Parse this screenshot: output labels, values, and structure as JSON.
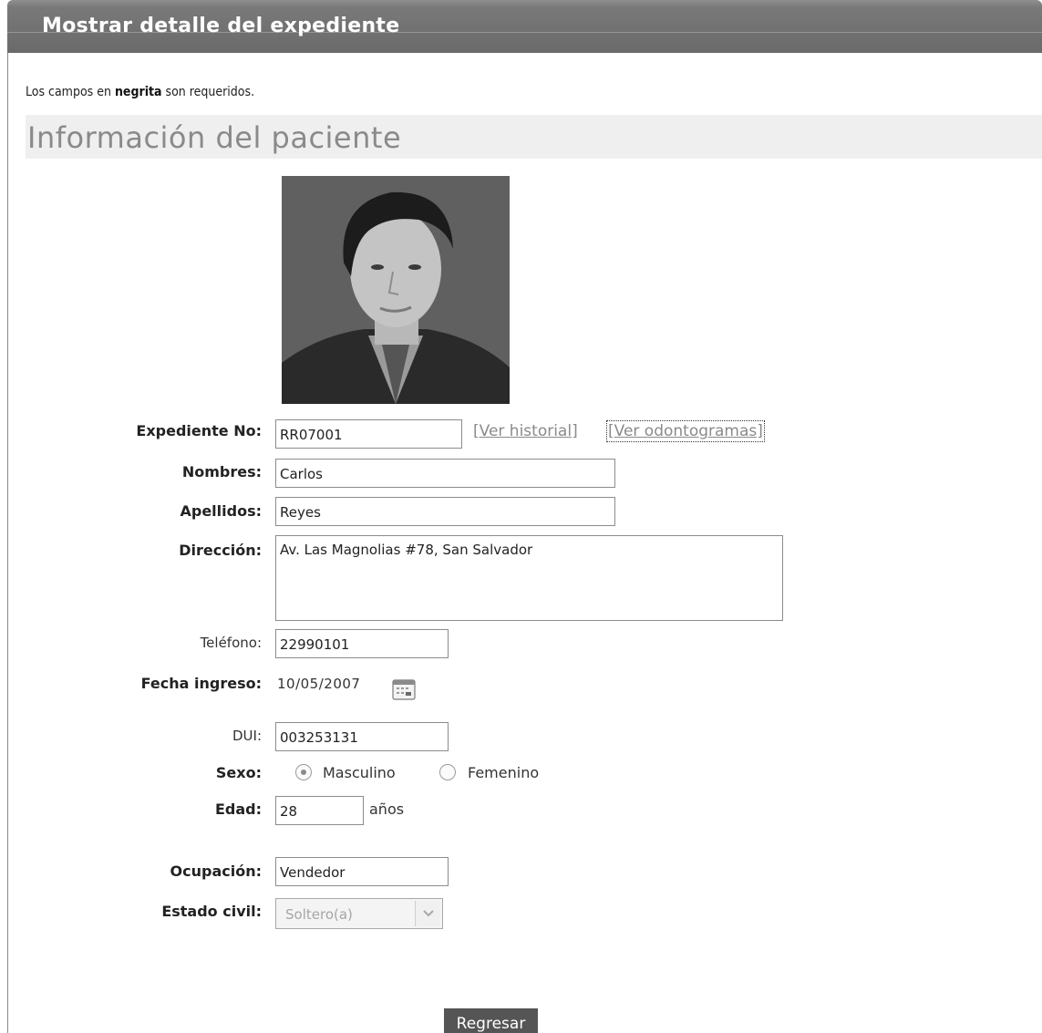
{
  "window": {
    "title": "Mostrar detalle del expediente"
  },
  "form": {
    "required_note_prefix": "Los campos en ",
    "required_note_bold": "negrita",
    "required_note_suffix": " son requeridos.",
    "section_title": "Información del paciente",
    "fields": {
      "expediente": {
        "label": "Expediente No:",
        "value": "RR07001"
      },
      "nombres": {
        "label": "Nombres:",
        "value": "Carlos"
      },
      "apellidos": {
        "label": "Apellidos:",
        "value": "Reyes"
      },
      "direccion": {
        "label": "Dirección:",
        "value": "Av. Las Magnolias #78, San Salvador"
      },
      "telefono": {
        "label": "Teléfono:",
        "value": "22990101"
      },
      "fecha_ingreso": {
        "label": "Fecha ingreso:",
        "value": "10/05/2007"
      },
      "dui": {
        "label": "DUI:",
        "value": "003253131"
      },
      "sexo": {
        "label": "Sexo:",
        "options": [
          "Masculino",
          "Femenino"
        ],
        "selected": "Masculino"
      },
      "edad": {
        "label": "Edad:",
        "value": "28",
        "suffix": "años"
      },
      "ocupacion": {
        "label": "Ocupación:",
        "value": "Vendedor"
      },
      "estado_civil": {
        "label": "Estado civil:",
        "value": "Soltero(a)"
      }
    },
    "links": {
      "historial": "[Ver historial]",
      "odontogramas": "[Ver odontogramas]"
    },
    "back_button": "Regresar"
  },
  "icons": {
    "calendar": "calendar-icon",
    "select_arrow": "chevron-down-icon"
  },
  "colors": {
    "header": "#777777",
    "section_bg": "#efefef",
    "section_title": "#8a8a8a",
    "link": "#8a8a8a",
    "button": "#555555"
  }
}
